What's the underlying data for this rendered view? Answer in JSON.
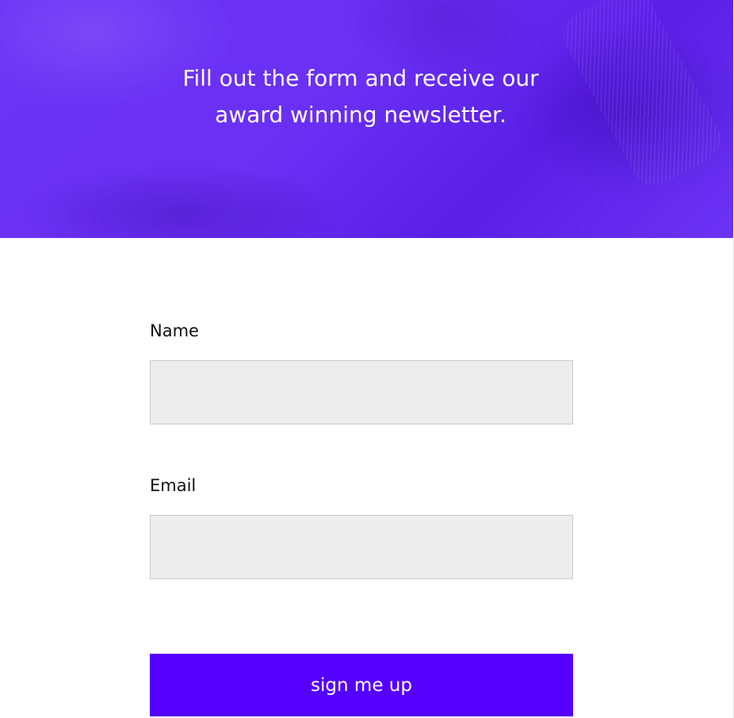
{
  "hero": {
    "heading_line1": "Fill out the form and receive our",
    "heading_line2": "award winning newsletter."
  },
  "form": {
    "name_label": "Name",
    "name_value": "",
    "email_label": "Email",
    "email_value": "",
    "submit_label": "sign me up"
  },
  "colors": {
    "hero_overlay": "#6a2ff3",
    "button": "#5500ff",
    "input_background": "#ededed",
    "input_border": "#c9c9c9"
  }
}
